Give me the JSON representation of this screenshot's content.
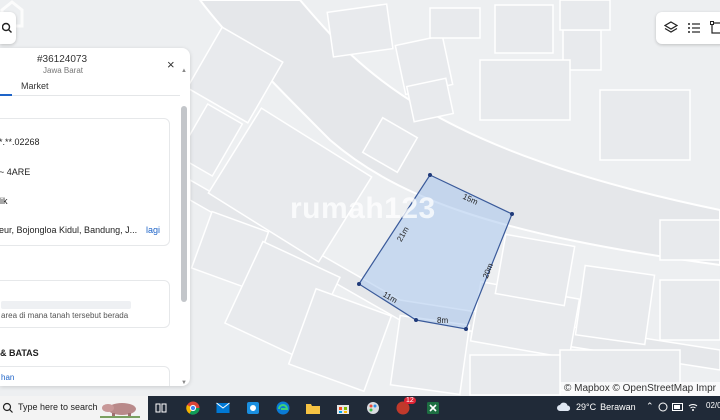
{
  "panel": {
    "listing_id": "#36124073",
    "region": "Jawa Barat",
    "close_glyph": "×",
    "tabs": [
      "Market"
    ],
    "info": {
      "parcel_number": "*.**.02268",
      "area": "~ 4ARE",
      "ownership": "lik",
      "address": "eur, Bojongloa Kidul, Bandung, J...",
      "more_link": "lagi"
    },
    "location_desc": "area di mana tanah tersebut berada",
    "section_title": "& BATAS",
    "section_link": "han"
  },
  "map": {
    "watermark": "rumah123",
    "attribution": "© Mapbox © OpenStreetMap  Impr",
    "parcel_color": "#a9c6ec",
    "parcel_stroke": "#3a5a9a",
    "segments": [
      "15m",
      "20m",
      "8m",
      "11m",
      "21m"
    ]
  },
  "toolbar": {
    "icons": [
      "layers-icon",
      "list-icon",
      "measure-icon"
    ]
  },
  "taskbar": {
    "search_text": "Type here to search",
    "weather_temp": "29°C",
    "weather_desc": "Berawan",
    "date": "02/0",
    "badge_count": "12",
    "apps": [
      "task-view-icon",
      "chrome-icon",
      "mail-icon",
      "snipping-icon",
      "edge-icon",
      "file-explorer-icon",
      "store-icon",
      "paint-icon",
      "notes-icon",
      "excel-icon"
    ]
  }
}
